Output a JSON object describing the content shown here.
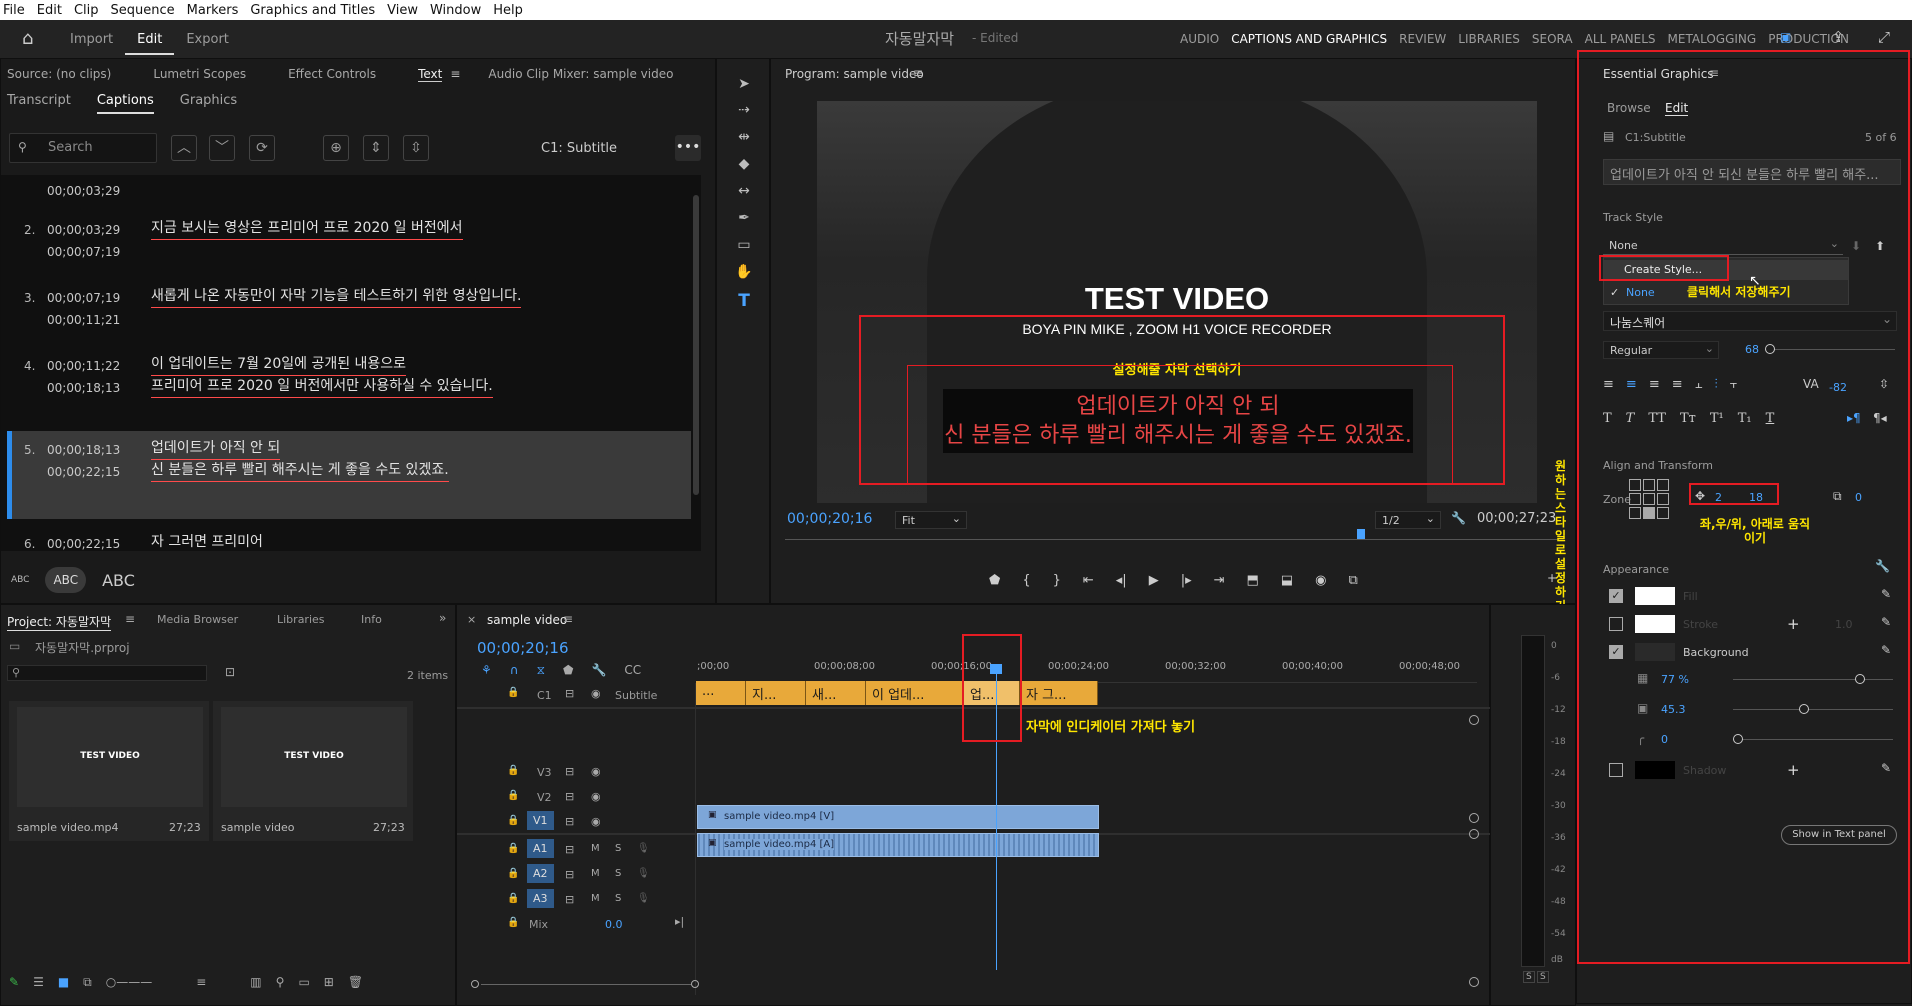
{
  "menu": [
    "File",
    "Edit",
    "Clip",
    "Sequence",
    "Markers",
    "Graphics and Titles",
    "View",
    "Window",
    "Help"
  ],
  "workspace": {
    "tabs": [
      "Import",
      "Edit",
      "Export"
    ],
    "active": "Edit",
    "title": "자동말자막",
    "edited": "- Edited",
    "panels": [
      "AUDIO",
      "CAPTIONS AND GRAPHICS",
      "REVIEW",
      "LIBRARIES",
      "SEORA",
      "ALL PANELS",
      "METALOGGING",
      "PRODUCTION"
    ]
  },
  "source_tabs": [
    "Source: (no clips)",
    "Lumetri Scopes",
    "Effect Controls",
    "Text",
    "Audio Clip Mixer: sample video"
  ],
  "text_tabs": [
    "Transcript",
    "Captions",
    "Graphics"
  ],
  "captions": {
    "search_placeholder": "Search",
    "track": "C1: Subtitle",
    "top_tc": "00;00;03;29",
    "rows": [
      {
        "num": "2.",
        "in": "00;00;03;29",
        "out": "00;00;07;19",
        "text": "지금 보시는 영상은 프리미어 프로 2020 일 버전에서"
      },
      {
        "num": "3.",
        "in": "00;00;07;19",
        "out": "00;00;11;21",
        "text": "새롭게 나온 자동만이 자막 기능을 테스트하기 위한 영상입니다."
      },
      {
        "num": "4.",
        "in": "00;00;11;22",
        "out": "00;00;18;13",
        "text": "이 업데이트는 7월 20일에 공개된 내용으로",
        "text2": "프리미어 프로 2020 일 버전에서만 사용하실 수 있습니다."
      },
      {
        "num": "5.",
        "in": "00;00;18;13",
        "out": "00;00;22;15",
        "text": "업데이트가 아직 안 되",
        "text2": "신 분들은 하루 빨리 해주시는 게 좋을 수도 있겠죠."
      },
      {
        "num": "6.",
        "in": "00;00;22;15",
        "out": "",
        "text": "자 그러면 프리미어"
      }
    ],
    "case_options": [
      "ABC",
      "ABC",
      "ABC"
    ]
  },
  "program": {
    "title": "Program: sample video",
    "video_title": "TEST VIDEO",
    "video_sub": "BOYA PIN MIKE , ZOOM H1 VOICE RECORDER",
    "caption_line1": "업데이트가 아직 안 되",
    "caption_line2": "신 분들은 하루 빨리 해주시는 게 좋을 수도 있겠죠.",
    "timecode": "00;00;20;16",
    "fit": "Fit",
    "resolution": "1/2",
    "duration": "00;00;27;23",
    "annot_select": "설정해줄 자막 선택하기",
    "annot_vertical": "원하는스타일로설정하기"
  },
  "project": {
    "tabs": [
      "Project: 자동말자막",
      "Media Browser",
      "Libraries",
      "Info"
    ],
    "file": "자동말자막.prproj",
    "count": "2 items",
    "items": [
      {
        "name": "sample video.mp4",
        "dur": "27;23"
      },
      {
        "name": "sample video",
        "dur": "27;23"
      }
    ]
  },
  "timeline": {
    "title": "sample video",
    "timecode": "00;00;20;16",
    "ruler": [
      ";00;00",
      "00;00;08;00",
      "00;00;16;00",
      "00;00;24;00",
      "00;00;32;00",
      "00;00;40;00",
      "00;00;48;00"
    ],
    "tracks": {
      "caption": "C1",
      "caption_name": "Subtitle",
      "video": [
        "V3",
        "V2",
        "V1"
      ],
      "audio": [
        "A1",
        "A2",
        "A3"
      ],
      "mix": "Mix",
      "mix_val": "0.0"
    },
    "clips": [
      "...",
      "지...",
      "새...",
      "이 업데...",
      "업...",
      "자 그..."
    ],
    "v1_clip": "sample video.mp4 [V]",
    "a1_clip": "sample video.mp4 [A]",
    "annot": "자막에 인디케이터 가져다 놓기"
  },
  "meter": {
    "labels": [
      "0",
      "-6",
      "-12",
      "-18",
      "-24",
      "-30",
      "-36",
      "-42",
      "-48",
      "-54"
    ],
    "db": "dB",
    "solo": [
      "S",
      "S"
    ]
  },
  "essential": {
    "title": "Essential Graphics",
    "tabs": [
      "Browse",
      "Edit"
    ],
    "layer": "C1:Subtitle",
    "page": "5 of 6",
    "text_preview": "업데이트가 아직 안 되신 분들은 하루 빨리 해주...",
    "track_style_label": "Track Style",
    "track_style_val": "None",
    "create_style": "Create Style...",
    "none_option": "None",
    "annot_save": "클릭해서 저장해주기",
    "font": "나눔스퀘어",
    "weight": "Regular",
    "size": "68",
    "tracking": "-82",
    "align_label": "Align and Transform",
    "zone": "Zone",
    "pos_x": "2",
    "pos_y": "18",
    "scale": "0",
    "annot_move": "좌,우/위, 아래로 움직이기",
    "appearance": "Appearance",
    "fill": "Fill",
    "stroke": "Stroke",
    "stroke_val": "1.0",
    "background": "Background",
    "bg_opacity": "77 %",
    "bg_size": "45.3",
    "corner": "0",
    "shadow": "Shadow",
    "show_text": "Show in Text panel"
  }
}
